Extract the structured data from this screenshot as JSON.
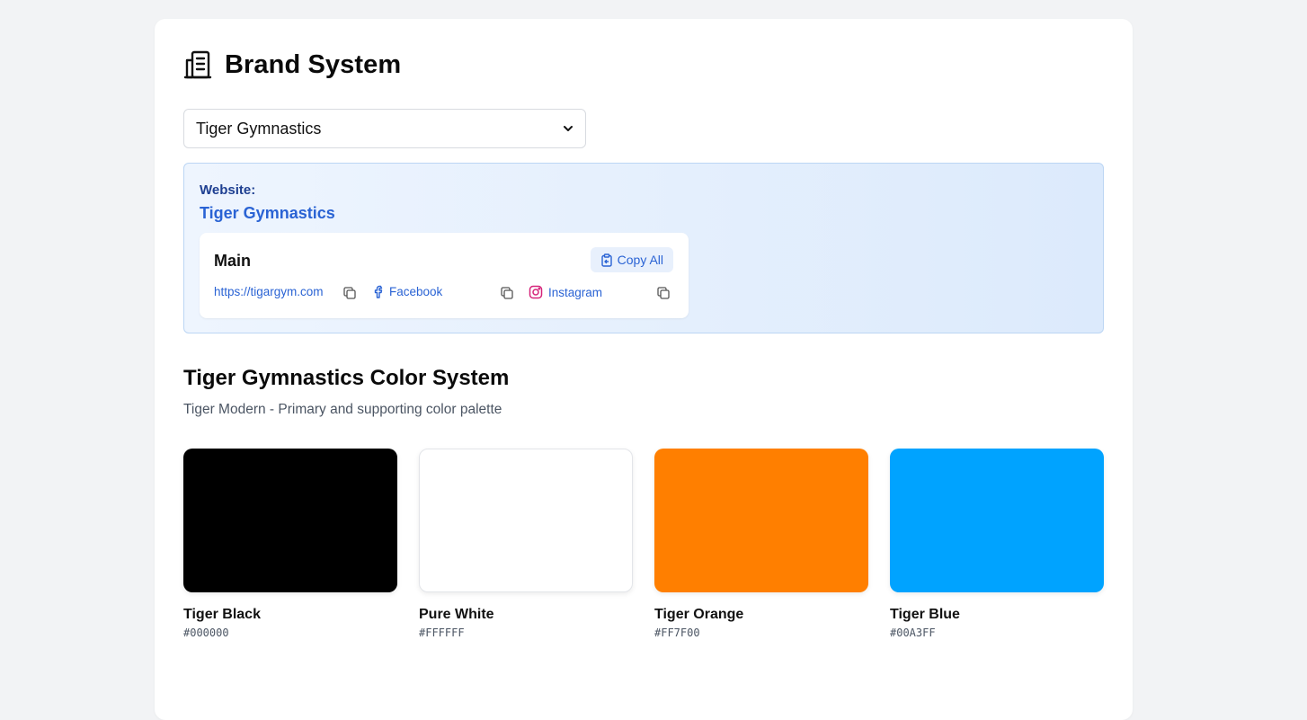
{
  "header": {
    "title": "Brand System",
    "icon": "building-icon"
  },
  "brand_select": {
    "selected": "Tiger Gymnastics"
  },
  "website": {
    "label": "Website:",
    "name": "Tiger Gymnastics",
    "group": {
      "title": "Main",
      "copy_all_label": "Copy All",
      "links": [
        {
          "text": "https://tigargym.com",
          "icon": ""
        },
        {
          "text": "Facebook",
          "icon": "facebook-icon"
        },
        {
          "text": "Instagram",
          "icon": "instagram-icon"
        }
      ]
    }
  },
  "colors": {
    "title": "Tiger Gymnastics Color System",
    "subtitle": "Tiger Modern - Primary and supporting color palette",
    "swatches": [
      {
        "name": "Tiger Black",
        "hex": "#000000"
      },
      {
        "name": "Pure White",
        "hex": "#FFFFFF"
      },
      {
        "name": "Tiger Orange",
        "hex": "#FF7F00"
      },
      {
        "name": "Tiger Blue",
        "hex": "#00A3FF"
      }
    ]
  },
  "theme": {
    "link_color": "#2a63d4",
    "panel_border": "#bcd6f4",
    "instagram": "#d6247a"
  }
}
